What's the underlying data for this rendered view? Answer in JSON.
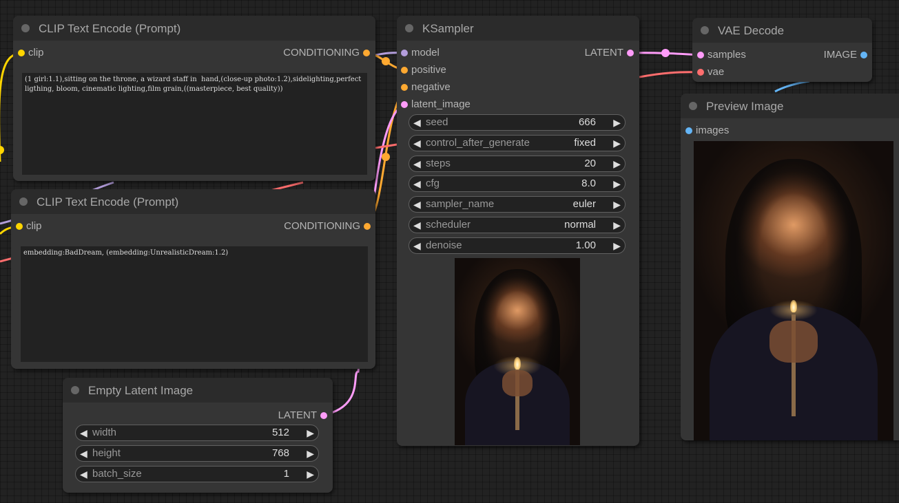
{
  "clip_top": {
    "title": "CLIP Text Encode (Prompt)",
    "input_clip": "clip",
    "output": "CONDITIONING",
    "text": "(1 girl:1.1),sitting on the throne, a wizard staff in  hand,(close-up photo:1.2),sidelighting,perfect ligthing, bloom, cinematic lighting,film grain,((masterpiece, best quality))"
  },
  "clip_bottom": {
    "title": "CLIP Text Encode (Prompt)",
    "input_clip": "clip",
    "output": "CONDITIONING",
    "text": "embedding:BadDream, (embedding:UnrealisticDream:1.2)"
  },
  "empty_latent": {
    "title": "Empty Latent Image",
    "output": "LATENT",
    "widgets": [
      {
        "label": "width",
        "value": "512"
      },
      {
        "label": "height",
        "value": "768"
      },
      {
        "label": "batch_size",
        "value": "1"
      }
    ]
  },
  "ksampler": {
    "title": "KSampler",
    "inputs": [
      "model",
      "positive",
      "negative",
      "latent_image"
    ],
    "output": "LATENT",
    "widgets": [
      {
        "label": "seed",
        "value": "666"
      },
      {
        "label": "control_after_generate",
        "value": "fixed"
      },
      {
        "label": "steps",
        "value": "20"
      },
      {
        "label": "cfg",
        "value": "8.0"
      },
      {
        "label": "sampler_name",
        "value": "euler"
      },
      {
        "label": "scheduler",
        "value": "normal"
      },
      {
        "label": "denoise",
        "value": "1.00"
      }
    ]
  },
  "vae_decode": {
    "title": "VAE Decode",
    "inputs": [
      "samples",
      "vae"
    ],
    "output": "IMAGE"
  },
  "preview": {
    "title": "Preview Image",
    "input": "images"
  },
  "arrows": {
    "left": "◀",
    "right": "▶"
  },
  "colors": {
    "clip": "#ffd500",
    "conditioning": "#ffa931",
    "model": "#b39ddb",
    "latent": "#ff9cf9",
    "vae": "#ff6e6e",
    "image": "#64b5f6"
  }
}
